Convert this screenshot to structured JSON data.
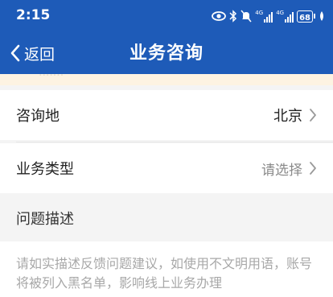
{
  "status_bar": {
    "time": "2:15",
    "signal_1": "4G",
    "signal_2": "4G",
    "battery": "68"
  },
  "nav": {
    "back_label": "返回",
    "title": "业务咨询"
  },
  "form": {
    "location": {
      "label": "咨询地",
      "value": "北京"
    },
    "business_type": {
      "label": "业务类型",
      "placeholder": "请选择"
    }
  },
  "description": {
    "title": "问题描述",
    "placeholder": "请如实描述反馈问题建议，如使用不文明用语，账号将被列入黑名单，影响线上业务办理"
  },
  "colors": {
    "header": "#1e5bb8",
    "notice": "#fdf3e2",
    "background": "#f4f4f4"
  }
}
